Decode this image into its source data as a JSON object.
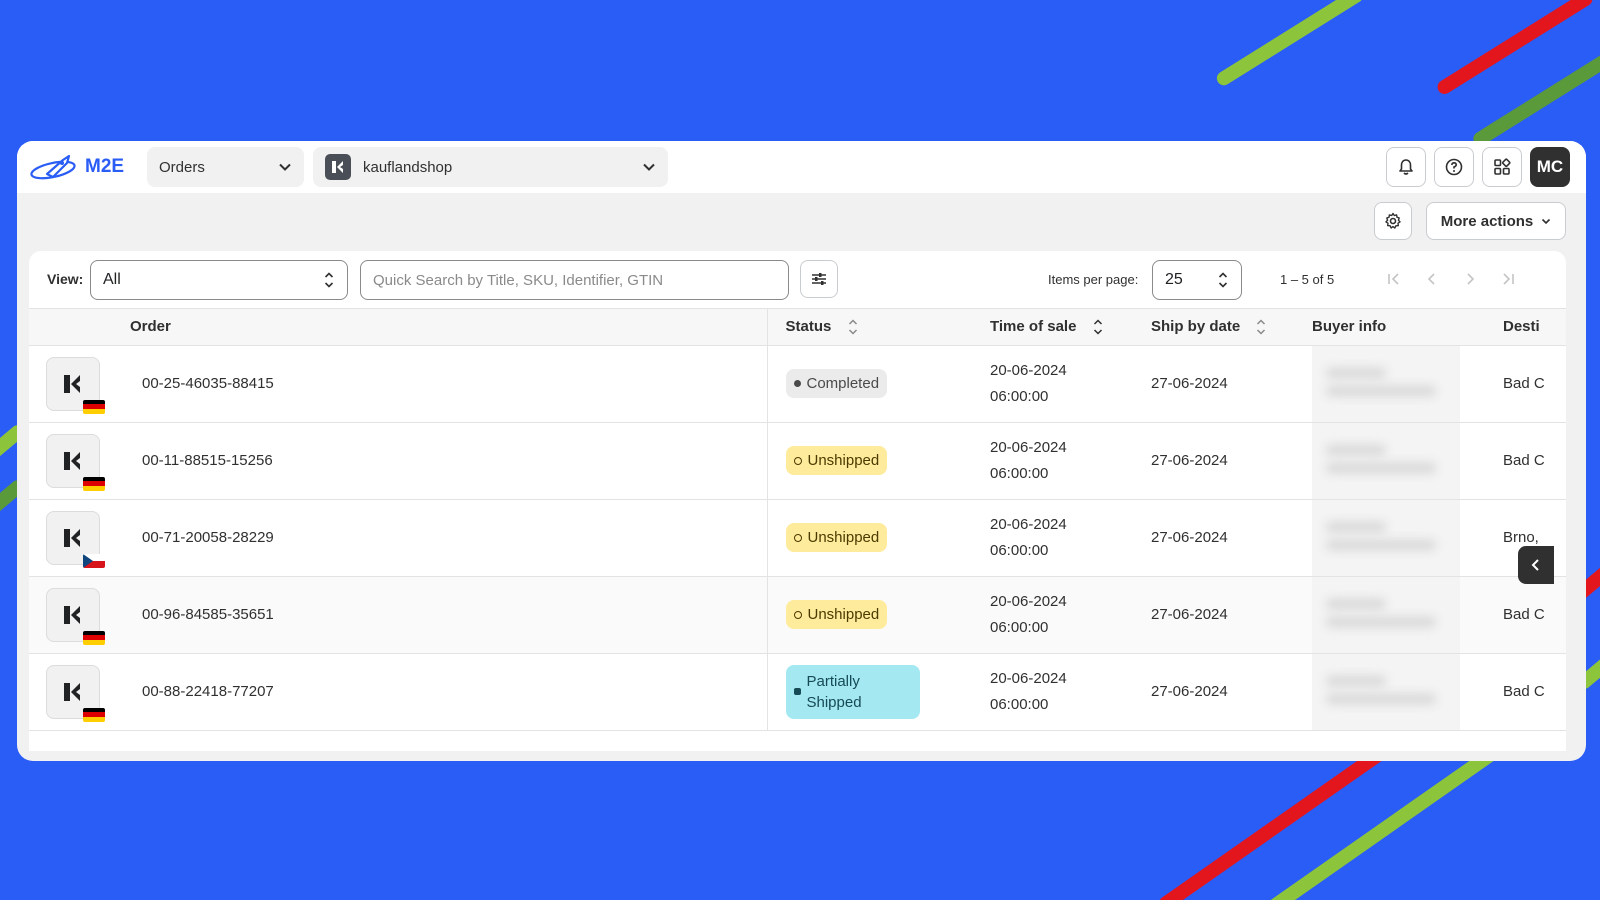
{
  "header": {
    "logo_text": "M2E",
    "section_dropdown": "Orders",
    "shop_dropdown": "kauflandshop",
    "avatar_initials": "MC",
    "icons": [
      "bell-icon",
      "help-icon",
      "apps-grid-icon"
    ]
  },
  "actions": {
    "more_actions_label": "More actions"
  },
  "filter": {
    "view_label": "View:",
    "view_value": "All",
    "search_placeholder": "Quick Search by Title, SKU, Identifier, GTIN",
    "items_per_page_label": "Items per page:",
    "items_per_page_value": "25",
    "range_text": "1 – 5 of 5"
  },
  "table": {
    "columns": {
      "order": "Order",
      "status": "Status",
      "time_of_sale": "Time of sale",
      "ship_by_date": "Ship by date",
      "buyer_info": "Buyer info",
      "destination": "Desti"
    },
    "rows": [
      {
        "order_id": "00-25-46035-88415",
        "flag": "DE",
        "status": "Completed",
        "status_type": "completed",
        "sale_date": "20-06-2024",
        "sale_time": "06:00:00",
        "ship_by": "27-06-2024",
        "destination": "Bad C"
      },
      {
        "order_id": "00-11-88515-15256",
        "flag": "DE",
        "status": "Unshipped",
        "status_type": "unshipped",
        "sale_date": "20-06-2024",
        "sale_time": "06:00:00",
        "ship_by": "27-06-2024",
        "destination": "Bad C"
      },
      {
        "order_id": "00-71-20058-28229",
        "flag": "CZ",
        "status": "Unshipped",
        "status_type": "unshipped",
        "sale_date": "20-06-2024",
        "sale_time": "06:00:00",
        "ship_by": "27-06-2024",
        "destination": "Brno,"
      },
      {
        "order_id": "00-96-84585-35651",
        "flag": "DE",
        "status": "Unshipped",
        "status_type": "unshipped",
        "sale_date": "20-06-2024",
        "sale_time": "06:00:00",
        "ship_by": "27-06-2024",
        "destination": "Bad C"
      },
      {
        "order_id": "00-88-22418-77207",
        "flag": "DE",
        "status": "Partially Shipped",
        "status_type": "partial",
        "sale_date": "20-06-2024",
        "sale_time": "06:00:00",
        "ship_by": "27-06-2024",
        "destination": "Bad C"
      }
    ]
  },
  "colors": {
    "background": "#2a5cf6",
    "brand": "#2a5cf6",
    "completed_badge": "#ebebeb",
    "unshipped_badge": "#ffeb9c",
    "partial_badge": "#a4e8f2"
  }
}
